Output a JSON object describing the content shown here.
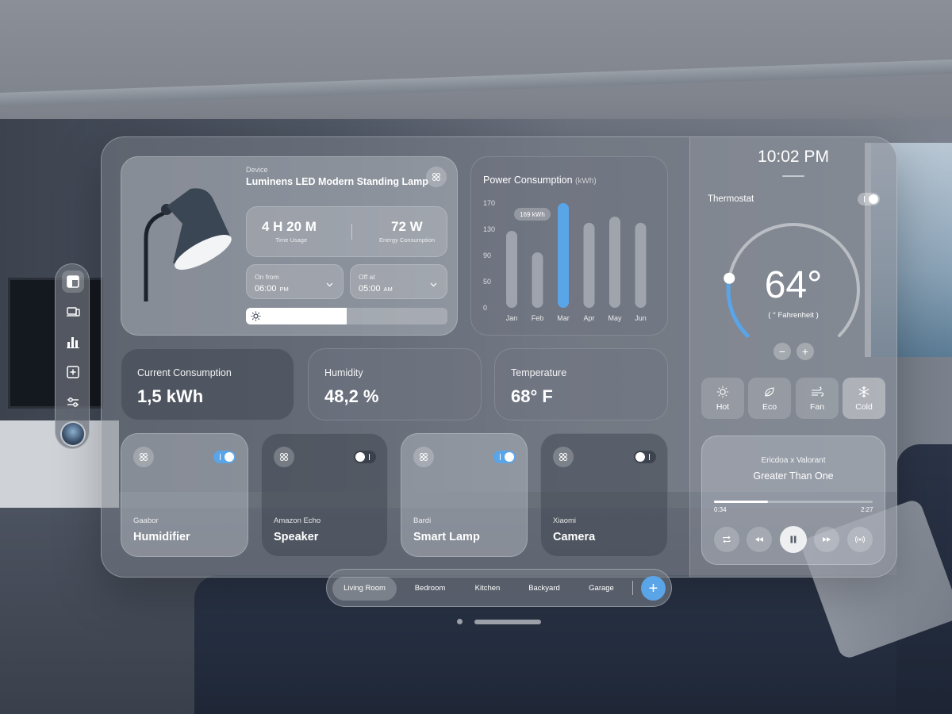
{
  "device": {
    "label": "Device",
    "name": "Luminens LED Modern Standing Lamp",
    "time_usage_value": "4 H  20 M",
    "time_usage_label": "Time Usage",
    "energy_value": "72 W",
    "energy_label": "Energy Consumption",
    "on_from_label": "On from",
    "on_from_time": "06:00",
    "on_from_ampm": "PM",
    "off_at_label": "Off at",
    "off_at_time": "05:00",
    "off_at_ampm": "AM",
    "brightness_fraction": 0.5
  },
  "chart_data": {
    "type": "bar",
    "title": "Power Consumption",
    "unit": "(kWh)",
    "categories": [
      "Jan",
      "Feb",
      "Mar",
      "Apr",
      "May",
      "Jun"
    ],
    "values": [
      125,
      90,
      170,
      138,
      148,
      138
    ],
    "highlight_index": 2,
    "highlight_label": "169 kWh",
    "y_ticks": [
      "170",
      "130",
      "90",
      "50",
      "0"
    ],
    "ylim": [
      0,
      170
    ],
    "colors": {
      "bar": "#a7acb5",
      "highlight": "#5aa4e8"
    }
  },
  "summary": {
    "current_label": "Current Consumption",
    "current_value": "1,5 kWh",
    "humidity_label": "Humidity",
    "humidity_value": "48,2 %",
    "temperature_label": "Temperature",
    "temperature_value": "68° F"
  },
  "tiles": [
    {
      "brand": "Gaabor",
      "name": "Humidifier",
      "on": true
    },
    {
      "brand": "Amazon Echo",
      "name": "Speaker",
      "on": false
    },
    {
      "brand": "Bardi",
      "name": "Smart Lamp",
      "on": true
    },
    {
      "brand": "Xiaomi",
      "name": "Camera",
      "on": false
    }
  ],
  "thermostat": {
    "clock": "10:02 PM",
    "label": "Thermostat",
    "enabled": true,
    "temperature": "64°",
    "unit_label": "( ° Fahrenheit )",
    "level_fraction": 0.28,
    "minus": "−",
    "plus": "+",
    "modes": [
      {
        "label": "Hot",
        "icon": "sun-icon",
        "active": false
      },
      {
        "label": "Eco",
        "icon": "leaf-icon",
        "active": false
      },
      {
        "label": "Fan",
        "icon": "wind-icon",
        "active": false
      },
      {
        "label": "Cold",
        "icon": "snowflake-icon",
        "active": true
      }
    ]
  },
  "music": {
    "artist": "Ericdoa x Valorant",
    "title": "Greater Than One",
    "elapsed": "0:34",
    "total": "2:27",
    "progress_fraction": 0.34
  },
  "rooms": {
    "tabs": [
      "Living Room",
      "Bedroom",
      "Kitchen",
      "Backyard",
      "Garage"
    ],
    "active": "Living Room",
    "add": "+"
  },
  "colors": {
    "accent": "#5aa4e8"
  }
}
